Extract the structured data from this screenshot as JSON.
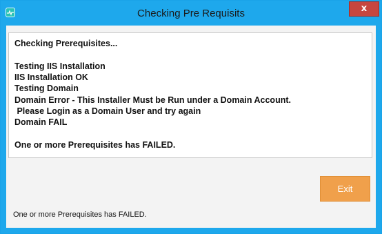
{
  "window": {
    "title": "Checking Pre Requisits",
    "close_label": "x"
  },
  "log": {
    "lines": [
      "Checking Prerequisites...",
      "",
      "Testing IIS Installation",
      "IIS Installation OK",
      "Testing Domain",
      "Domain Error - This Installer Must be Run under a Domain Account.",
      " Please Login as a Domain User and try again",
      "Domain FAIL",
      "",
      "One or more Prerequisites has FAILED."
    ]
  },
  "buttons": {
    "exit_label": "Exit"
  },
  "status": {
    "text": "One or more Prerequisites has FAILED."
  },
  "colors": {
    "titlebar": "#1ea8ec",
    "close_button": "#c7463f",
    "exit_button": "#f0a04b"
  },
  "icons": {
    "app": "app-icon",
    "close": "close-icon"
  }
}
